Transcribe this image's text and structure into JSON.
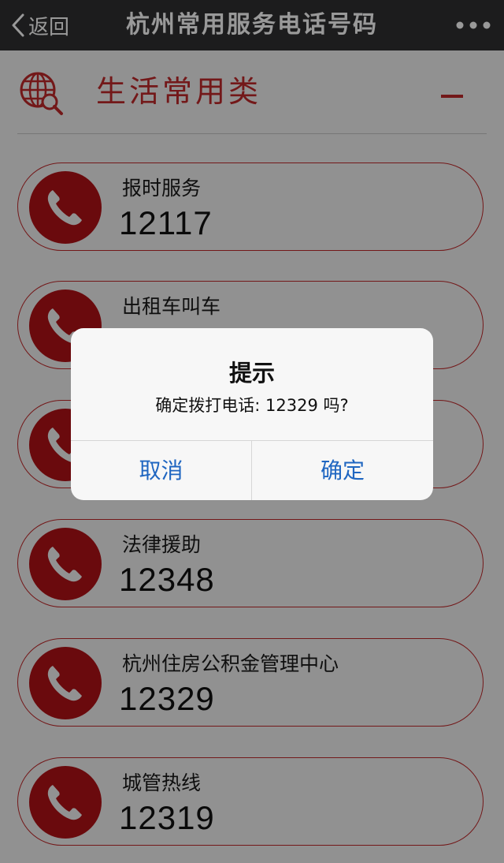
{
  "navbar": {
    "back_label": "返回",
    "title": "杭州常用服务电话号码"
  },
  "section": {
    "title": "生活常用类"
  },
  "rows": [
    {
      "name": "报时服务",
      "number": "12117"
    },
    {
      "name": "出租车叫车",
      "number": ""
    },
    {
      "name": "",
      "number": ""
    },
    {
      "name": "法律援助",
      "number": "12348"
    },
    {
      "name": "杭州住房公积金管理中心",
      "number": "12329"
    },
    {
      "name": "城管热线",
      "number": "12319"
    }
  ],
  "dialog": {
    "title": "提示",
    "message": "确定拨打电话: 12329 吗?",
    "cancel_label": "取消",
    "confirm_label": "确定"
  },
  "colors": {
    "accent": "#c0282a",
    "icon_circle": "#b11217",
    "dialog_button": "#1f66c1",
    "navbar": "#2f2f31"
  }
}
